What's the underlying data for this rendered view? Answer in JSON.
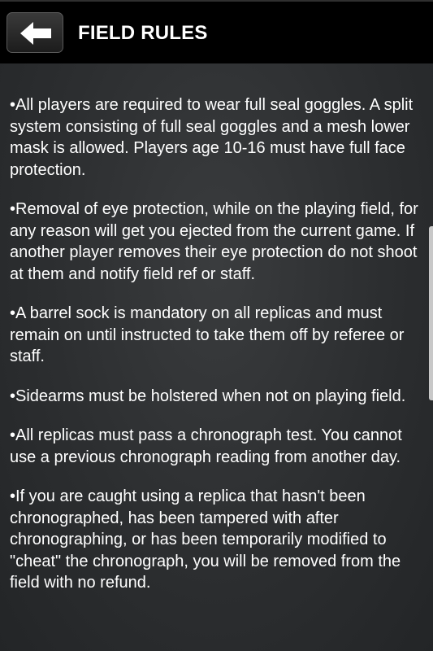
{
  "header": {
    "title": "FIELD RULES",
    "back_icon": "back-arrow-icon"
  },
  "rules": [
    "•All players are required to wear full seal goggles. A split system consisting of full seal goggles and a mesh lower mask is allowed. Players age 10-16 must have full face protection.",
    "•Removal of eye protection, while on the playing field, for any reason will get you ejected from the current game. If another player removes their eye protection do not shoot at them and notify field ref or staff.",
    "•A barrel sock is mandatory on all replicas and must remain on until instructed to take them off by referee or staff.",
    "•Sidearms must be holstered when not on playing field.",
    "•All replicas must pass a chronograph test. You cannot use a previous chronograph reading from another day.",
    "•If you are caught using a replica that hasn't been chronographed, has been tampered with after chronographing, or has been temporarily modified to \"cheat\" the chronograph, you will be removed from the field with no refund."
  ],
  "colors": {
    "header_bg": "#000000",
    "text": "#ffffff",
    "background": "#2c2e30"
  }
}
